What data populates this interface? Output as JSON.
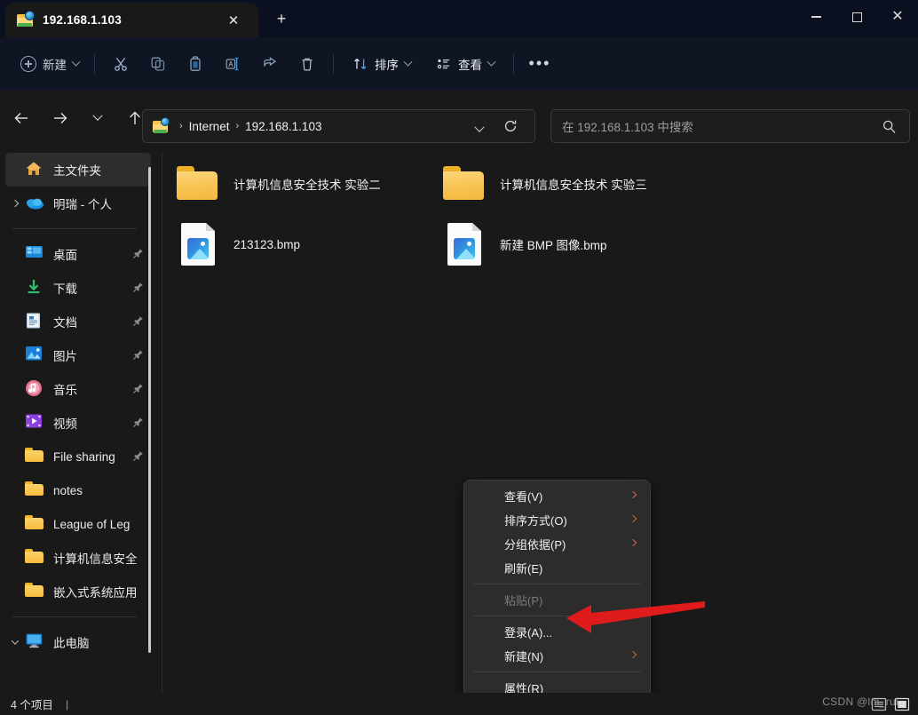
{
  "window": {
    "tab_title": "192.168.1.103",
    "tab_icon": "network-folder-icon",
    "new_tab_label": "+",
    "close_tab_label": "✕",
    "minimize_label": "minimize",
    "maximize_label": "maximize",
    "close_label": "✕"
  },
  "toolbar": {
    "new_label": "新建",
    "cut_label": "cut-icon",
    "copy_label": "copy-icon",
    "paste_label": "paste-icon",
    "rename_label": "rename-icon",
    "share_label": "share-icon",
    "delete_label": "delete-icon",
    "sort_label": "排序",
    "view_label": "查看",
    "more_label": "•••"
  },
  "address": {
    "crumb_icon": "network-folder-icon",
    "crumbs": [
      "Internet",
      "192.168.1.103"
    ],
    "separator": "›",
    "dropdown": "chevron-down-icon",
    "refresh": "refresh-icon"
  },
  "search": {
    "placeholder": "在 192.168.1.103 中搜索",
    "icon": "search-icon"
  },
  "sidebar": {
    "items": [
      {
        "label": "主文件夹",
        "icon": "home-icon",
        "selected": true,
        "pinned": false,
        "expander": "none"
      },
      {
        "label": "明瑞 - 个人",
        "icon": "onedrive-icon",
        "selected": false,
        "pinned": false,
        "expander": "right"
      },
      {
        "label": "桌面",
        "icon": "desktop-icon",
        "selected": false,
        "pinned": true,
        "expander": "none"
      },
      {
        "label": "下载",
        "icon": "downloads-icon",
        "selected": false,
        "pinned": true,
        "expander": "none"
      },
      {
        "label": "文档",
        "icon": "documents-icon",
        "selected": false,
        "pinned": true,
        "expander": "none"
      },
      {
        "label": "图片",
        "icon": "pictures-icon",
        "selected": false,
        "pinned": true,
        "expander": "none"
      },
      {
        "label": "音乐",
        "icon": "music-icon",
        "selected": false,
        "pinned": true,
        "expander": "none"
      },
      {
        "label": "视频",
        "icon": "videos-icon",
        "selected": false,
        "pinned": true,
        "expander": "none"
      },
      {
        "label": "File sharing",
        "icon": "folder-icon",
        "selected": false,
        "pinned": true,
        "expander": "none"
      },
      {
        "label": "notes",
        "icon": "folder-icon",
        "selected": false,
        "pinned": false,
        "expander": "none"
      },
      {
        "label": "League of Leg",
        "icon": "folder-icon",
        "selected": false,
        "pinned": false,
        "expander": "none"
      },
      {
        "label": "计算机信息安全",
        "icon": "folder-icon",
        "selected": false,
        "pinned": false,
        "expander": "none"
      },
      {
        "label": "嵌入式系统应用",
        "icon": "folder-icon",
        "selected": false,
        "pinned": false,
        "expander": "none"
      },
      {
        "label": "此电脑",
        "icon": "this-pc-icon",
        "selected": false,
        "pinned": false,
        "expander": "down"
      }
    ]
  },
  "files": [
    {
      "name": "计算机信息安全技术 实验二",
      "type": "folder"
    },
    {
      "name": "计算机信息安全技术 实验三",
      "type": "folder"
    },
    {
      "name": "213123.bmp",
      "type": "bmp"
    },
    {
      "name": "新建 BMP 图像.bmp",
      "type": "bmp"
    }
  ],
  "context_menu": {
    "items": [
      {
        "label": "查看(V)",
        "submenu": true,
        "disabled": false,
        "separator_after": false
      },
      {
        "label": "排序方式(O)",
        "submenu": true,
        "disabled": false,
        "separator_after": false
      },
      {
        "label": "分组依据(P)",
        "submenu": true,
        "disabled": false,
        "separator_after": false
      },
      {
        "label": "刷新(E)",
        "submenu": false,
        "disabled": false,
        "separator_after": true
      },
      {
        "label": "粘贴(P)",
        "submenu": false,
        "disabled": true,
        "separator_after": true
      },
      {
        "label": "登录(A)...",
        "submenu": false,
        "disabled": false,
        "separator_after": false
      },
      {
        "label": "新建(N)",
        "submenu": true,
        "disabled": false,
        "separator_after": true
      },
      {
        "label": "属性(R)",
        "submenu": false,
        "disabled": false,
        "separator_after": false
      }
    ]
  },
  "annotation": {
    "arrow_color": "#e01b1b",
    "arrow_target": "登录(A)..."
  },
  "statusbar": {
    "item_count": "4 个项目",
    "divider": "|",
    "details_view_icon": "details-view-icon",
    "large_icons_view_icon": "large-icons-view-icon"
  },
  "watermark": {
    "text": "CSDN @lm_rui"
  },
  "colors": {
    "window_bg": "#191919",
    "titlebar_bg": "#0b1020",
    "commandbar_bg": "#101524",
    "menu_bg": "#2c2c2c",
    "accent_folder": "#f5bd3c",
    "accent_arrow": "#e01b1b"
  }
}
